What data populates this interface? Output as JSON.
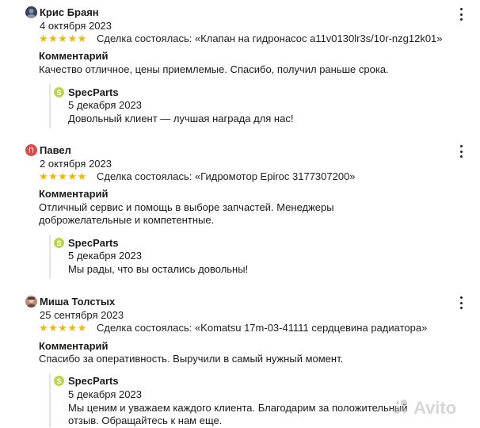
{
  "reviews": [
    {
      "author": "Крис Браян",
      "date": "4 октября 2023",
      "rating": "★★★★★",
      "deal": "Сделка состоялась: «Клапан на гидронасос a11v0130lr3s/10r-nzg12k01»",
      "comment_title": "Комментарий",
      "comment": "Качество отличное, цены приемлемые. Спасибо, получил раньше срока.",
      "reply": {
        "seller": "SpecParts",
        "date": "5 декабря 2023",
        "text": "Довольный клиент — лучшая награда для нас!"
      }
    },
    {
      "author": "Павел",
      "avatar_letter": "П",
      "date": "2 октября 2023",
      "rating": "★★★★★",
      "deal": "Сделка состоялась: «Гидромотор Epiroc 3177307200»",
      "comment_title": "Комментарий",
      "comment": "Отличный сервис и помощь в выборе запчастей. Менеджеры доброжелательные и компетентные.",
      "reply": {
        "seller": "SpecParts",
        "date": "5 декабря 2023",
        "text": "Мы рады, что вы остались довольны!"
      }
    },
    {
      "author": "Миша Толстых",
      "date": "25 сентября 2023",
      "rating": "★★★★★",
      "deal": "Сделка состоялась: «Komatsu 17m-03-41111 сердцевина радиатора»",
      "comment_title": "Комментарий",
      "comment": "Спасибо за оперативность. Выручили в самый нужный момент.",
      "reply": {
        "seller": "SpecParts",
        "date": "5 декабря 2023",
        "text": "Мы ценим и уважаем каждого клиента. Благодарим за положительный отзыв. Обращайтесь к нам еще."
      }
    }
  ],
  "seller_badge_letter": "S",
  "watermark": "Avito",
  "colors": {
    "star": "#f5b400",
    "badge": "#b8d84a",
    "avatar_pavel": "#e04a4a"
  }
}
